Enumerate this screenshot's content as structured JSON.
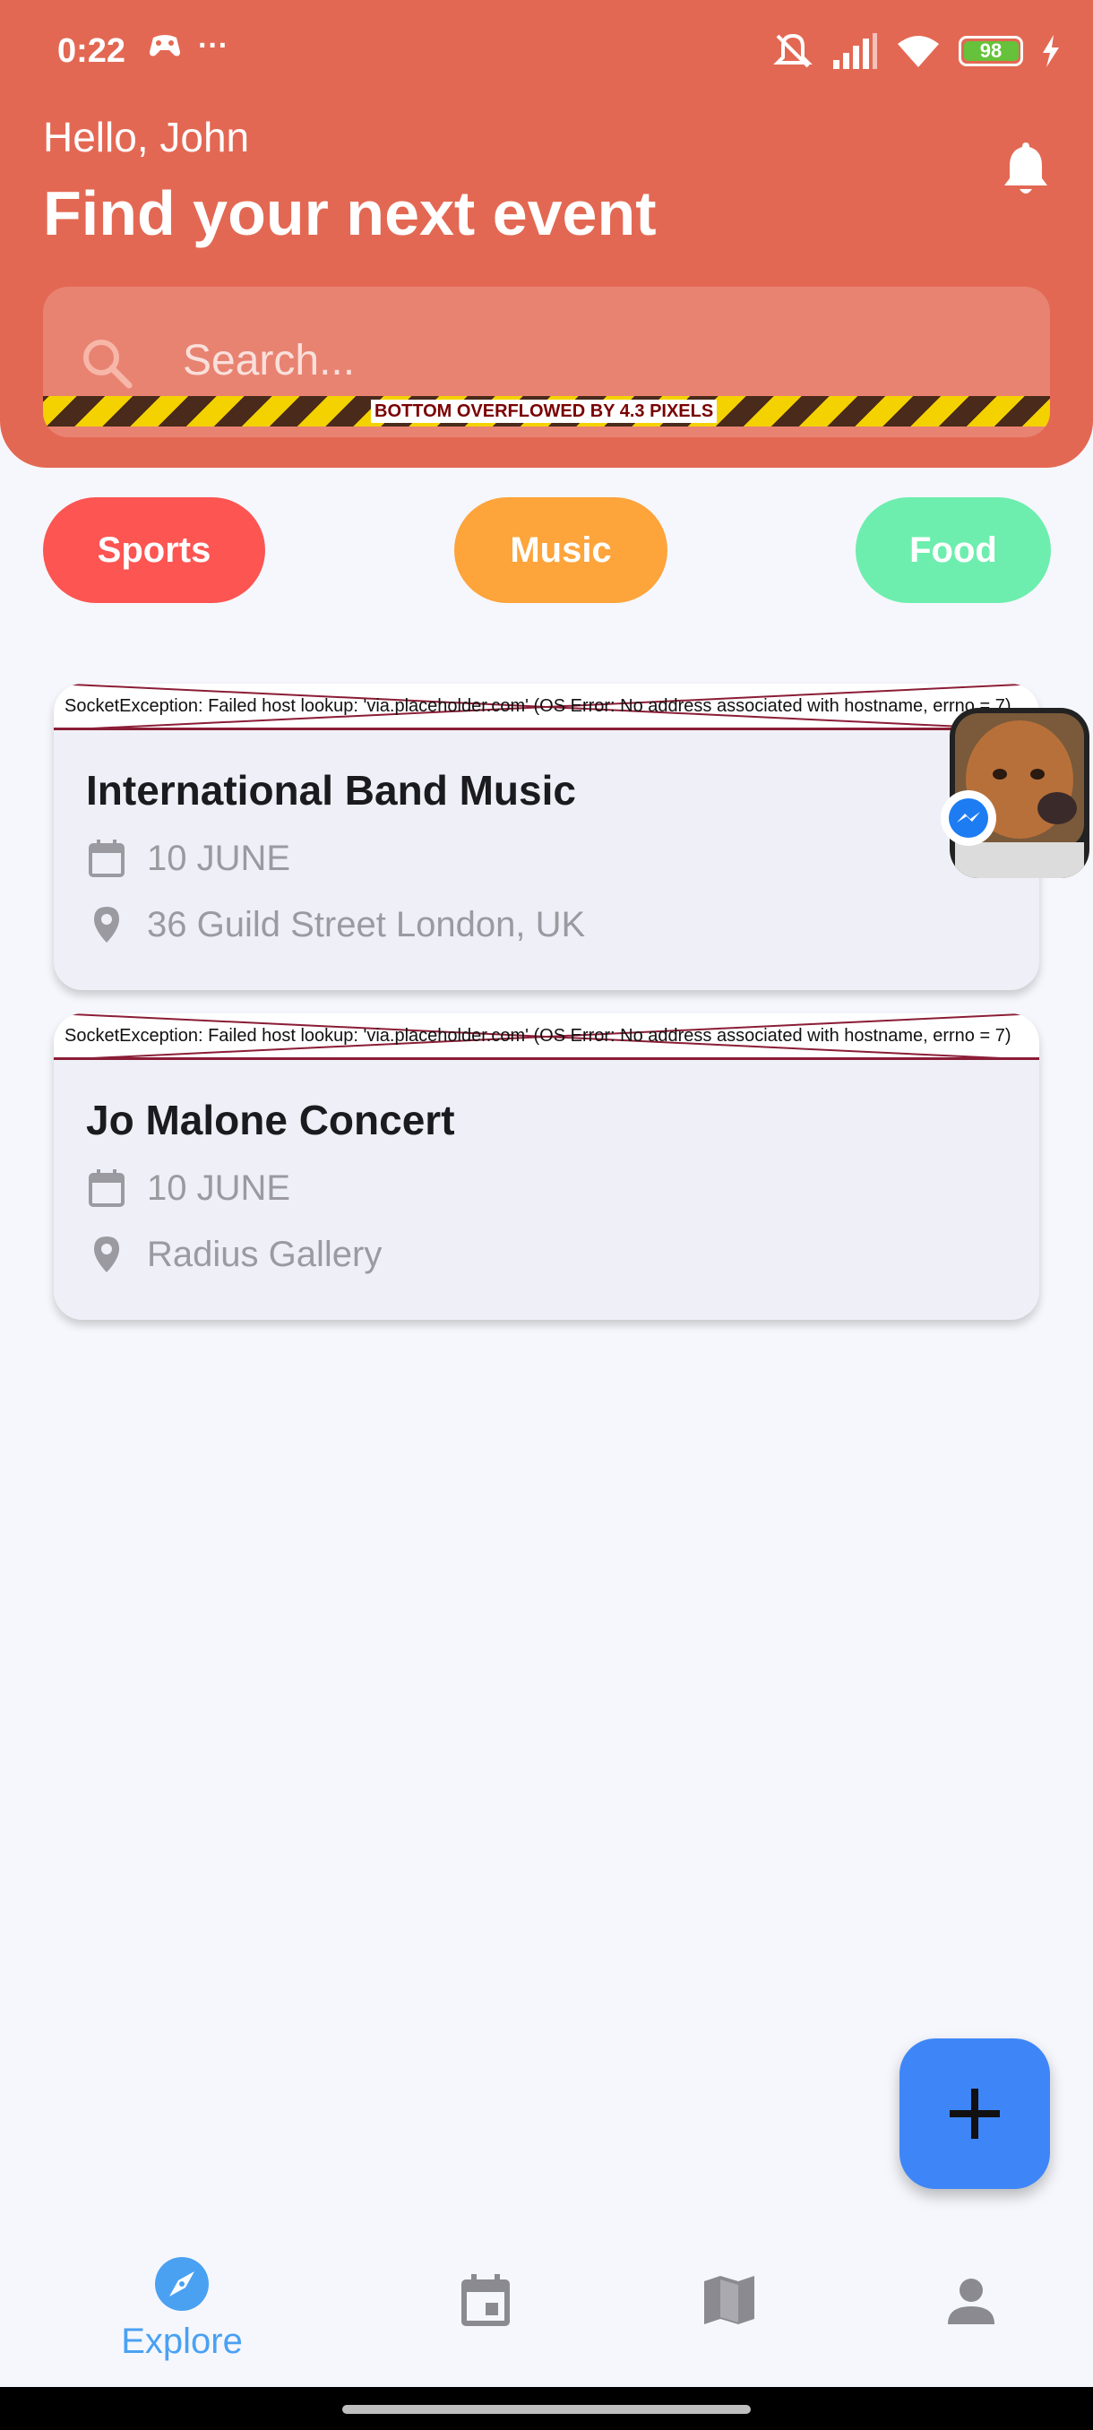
{
  "status_bar": {
    "time": "0:22",
    "dots": "···",
    "battery": "98"
  },
  "header": {
    "greeting": "Hello, John",
    "headline": "Find your next event"
  },
  "search": {
    "placeholder": "Search...",
    "overflow_warning": "BOTTOM OVERFLOWED BY 4.3 PIXELS"
  },
  "categories": [
    {
      "label": "Sports",
      "color": "#fd5552"
    },
    {
      "label": "Music",
      "color": "#fda43b"
    },
    {
      "label": "Food",
      "color": "#6deeae"
    }
  ],
  "events": [
    {
      "image_error": "SocketException: Failed host lookup: 'via.placeholder.com' (OS Error: No address associated with hostname, errno = 7)",
      "title": "International Band Music",
      "date": "10 JUNE",
      "location": "36 Guild Street London, UK"
    },
    {
      "image_error": "SocketException: Failed host lookup: 'via.placeholder.com' (OS Error: No address associated with hostname, errno = 7)",
      "title": "Jo Malone Concert",
      "date": "10 JUNE",
      "location": "Radius Gallery"
    }
  ],
  "bottom_nav": {
    "active": "Explore",
    "items": [
      {
        "label": "Explore",
        "icon": "compass-icon"
      },
      {
        "label": "",
        "icon": "calendar-icon"
      },
      {
        "label": "",
        "icon": "map-icon"
      },
      {
        "label": "",
        "icon": "person-icon"
      }
    ]
  },
  "colors": {
    "header": "#e36853",
    "accent": "#3e86f7",
    "nav_active": "#4aa1f2"
  }
}
